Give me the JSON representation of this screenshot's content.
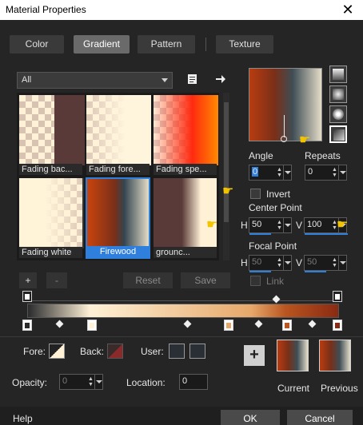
{
  "window": {
    "title": "Material Properties",
    "close_glyph": "✕"
  },
  "tabs": [
    {
      "label": "Color",
      "active": false
    },
    {
      "label": "Gradient",
      "active": true
    },
    {
      "label": "Pattern",
      "active": false
    },
    {
      "label": "Texture",
      "active": false
    }
  ],
  "category_select": {
    "value": "All"
  },
  "gradients": [
    {
      "label": "Fading bac...",
      "selected": false
    },
    {
      "label": "Fading fore...",
      "selected": false
    },
    {
      "label": "Fading spe...",
      "selected": false
    },
    {
      "label": "Fading white",
      "selected": false
    },
    {
      "label": "Firewood",
      "selected": true
    },
    {
      "label": "grounc...",
      "selected": false
    }
  ],
  "gradient_buttons": {
    "add": "+",
    "remove": "-",
    "reset": "Reset",
    "save": "Save"
  },
  "angle": {
    "label": "Angle",
    "value": "0"
  },
  "repeats": {
    "label": "Repeats",
    "value": "0"
  },
  "invert": {
    "label": "Invert",
    "checked": false
  },
  "center_point": {
    "label": "Center Point",
    "h_label": "H",
    "h_value": "50",
    "v_label": "V",
    "v_value": "100"
  },
  "focal_point": {
    "label": "Focal Point",
    "h_label": "H",
    "h_value": "50",
    "v_label": "V",
    "v_value": "50",
    "link_label": "Link"
  },
  "fore": {
    "label": "Fore:"
  },
  "back": {
    "label": "Back:"
  },
  "user": {
    "label": "User:"
  },
  "opacity": {
    "label": "Opacity:",
    "value": "0"
  },
  "location": {
    "label": "Location:",
    "value": "0"
  },
  "current_label": "Current",
  "previous_label": "Previous",
  "add_swatch": "+",
  "help_label": "Help",
  "ok_label": "OK",
  "cancel_label": "Cancel",
  "colors": {
    "accent": "#2f7fdc",
    "firewood_start": "#b83c10",
    "firewood_end": "#e4dcc8"
  }
}
